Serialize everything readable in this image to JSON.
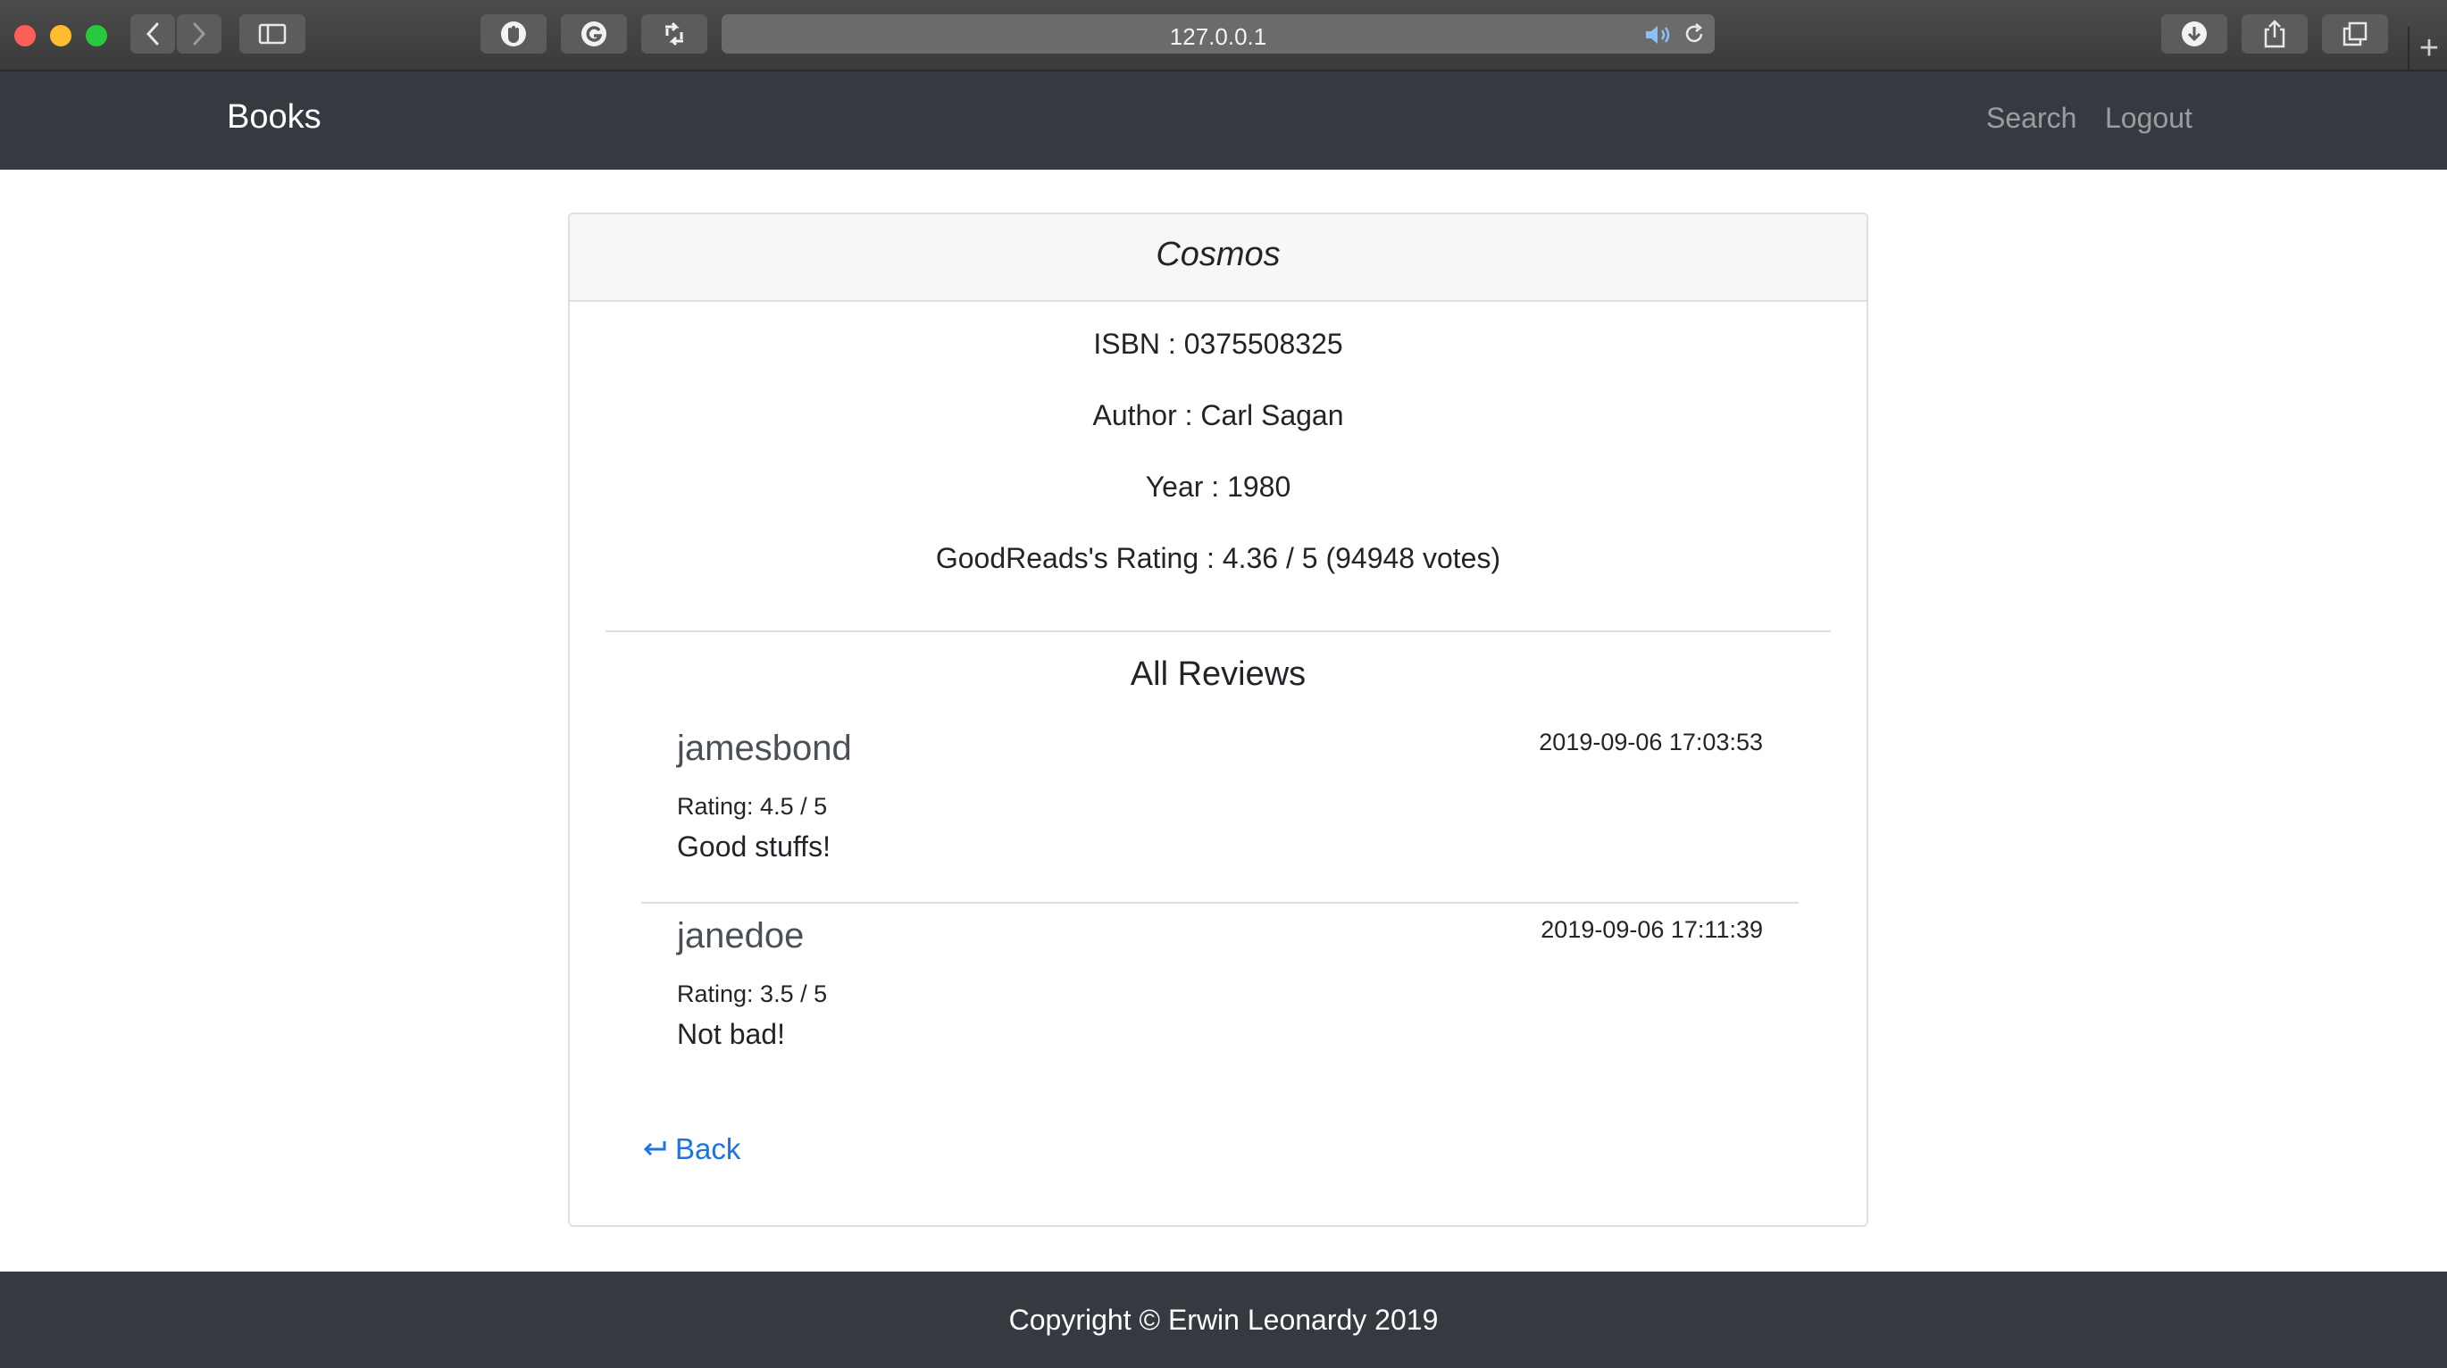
{
  "browser": {
    "url": "127.0.0.1",
    "newtab_label": "+"
  },
  "navbar": {
    "brand": "Books",
    "links": [
      {
        "label": "Search"
      },
      {
        "label": "Logout"
      }
    ]
  },
  "book": {
    "title": "Cosmos",
    "isbn": "ISBN : 0375508325",
    "author": "Author : Carl Sagan",
    "year": "Year : 1980",
    "goodreads_rating": "GoodReads's Rating : 4.36 / 5 (94948 votes)"
  },
  "reviews": {
    "heading": "All Reviews",
    "items": [
      {
        "user": "jamesbond",
        "date": "2019-09-06 17:03:53",
        "rating": "Rating: 4.5 / 5",
        "text": "Good stuffs!"
      },
      {
        "user": "janedoe",
        "date": "2019-09-06 17:11:39",
        "rating": "Rating: 3.5 / 5",
        "text": "Not bad!"
      }
    ]
  },
  "back_label": "Back",
  "footer": {
    "text": "Copyright © Erwin Leonardy 2019"
  },
  "colors": {
    "navbar_bg": "#343a40",
    "link": "#1a73e8"
  },
  "icons": {
    "back": "return-arrow-icon",
    "toolbar": [
      "chevron-left-icon",
      "chevron-right-icon",
      "sidebar-icon",
      "extension-shield-icon",
      "grammarly-icon",
      "extension-arrows-icon",
      "speaker-icon",
      "reload-icon",
      "download-icon",
      "share-icon",
      "tabs-icon"
    ]
  }
}
